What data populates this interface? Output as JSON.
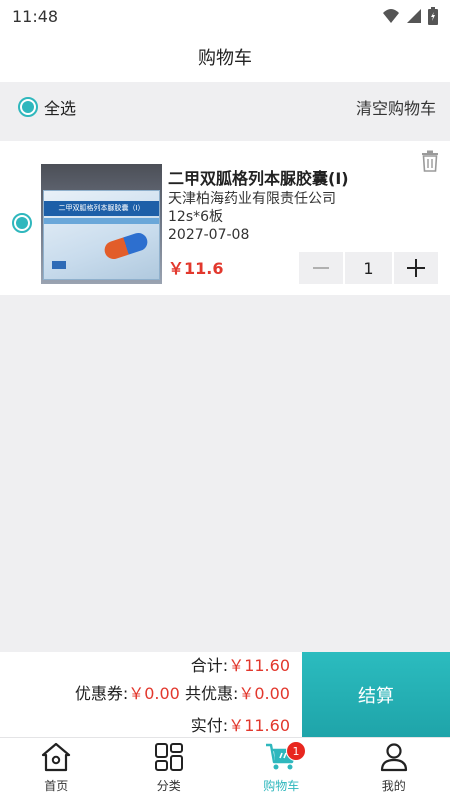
{
  "status": {
    "time": "11:48"
  },
  "nav": {
    "title": "购物车"
  },
  "select_bar": {
    "select_all_label": "全选",
    "clear_label": "清空购物车"
  },
  "cart": {
    "items": [
      {
        "name": "二甲双胍格列本脲胶囊(Ⅰ)",
        "manufacturer": "天津柏海药业有限责任公司",
        "spec": "12s*6板",
        "expiry": "2027-07-08",
        "price": "￥11.6",
        "quantity": "1",
        "thumb_text": "二甲双胍格列本脲胶囊（I）"
      }
    ]
  },
  "summary": {
    "total_label": "合计:",
    "total_value": "￥11.60",
    "coupon_label": "优惠券:",
    "coupon_value": "￥0.00",
    "discount_label": "共优惠:",
    "discount_value": "￥0.00",
    "paid_label": "实付:",
    "paid_value": "￥11.60",
    "checkout_label": "结算"
  },
  "tabs": [
    {
      "label": "首页",
      "icon": "home-icon"
    },
    {
      "label": "分类",
      "icon": "category-grid-icon"
    },
    {
      "label": "购物车",
      "icon": "cart-icon",
      "badge": "1",
      "active": true
    },
    {
      "label": "我的",
      "icon": "profile-icon"
    }
  ],
  "colors": {
    "accent": "#2fb7bd",
    "price": "#e2382d",
    "badge": "#e8271f"
  }
}
